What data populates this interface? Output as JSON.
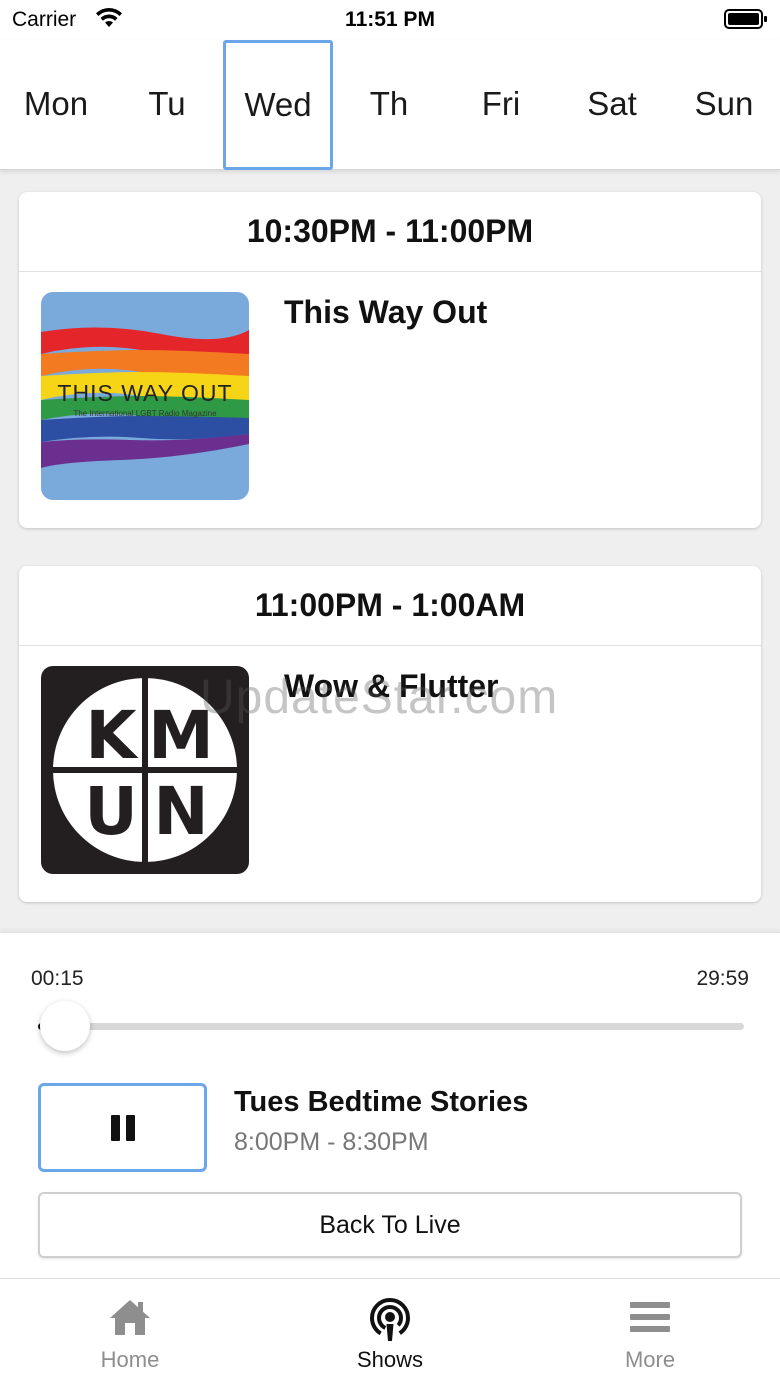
{
  "status_bar": {
    "carrier": "Carrier",
    "time": "11:51 PM"
  },
  "days": [
    "Mon",
    "Tu",
    "Wed",
    "Th",
    "Fri",
    "Sat",
    "Sun"
  ],
  "selected_day": "Wed",
  "shows": [
    {
      "time": "10:30PM - 11:00PM",
      "title": "This Way Out",
      "thumb_text": "THIS WAY OUT",
      "thumb_subtext": "The International LGBT Radio Magazine"
    },
    {
      "time": "11:00PM - 1:00AM",
      "title": "Wow & Flutter",
      "thumb_text": [
        "K",
        "M",
        "U",
        "N"
      ]
    }
  ],
  "watermark": "UpdateStar.com",
  "player": {
    "elapsed": "00:15",
    "total": "29:59",
    "progress": 0.008,
    "now_playing_title": "Tues Bedtime Stories",
    "now_playing_time": "8:00PM - 8:30PM",
    "back_to_live_label": "Back To Live",
    "state": "playing"
  },
  "tab_bar": {
    "items": [
      {
        "label": "Home",
        "icon": "home-icon",
        "active": false
      },
      {
        "label": "Shows",
        "icon": "podcast-icon",
        "active": true
      },
      {
        "label": "More",
        "icon": "menu-icon",
        "active": false
      }
    ]
  },
  "colors": {
    "accent": "#6aa6e8",
    "inactive_tab": "#8e8e8e"
  }
}
